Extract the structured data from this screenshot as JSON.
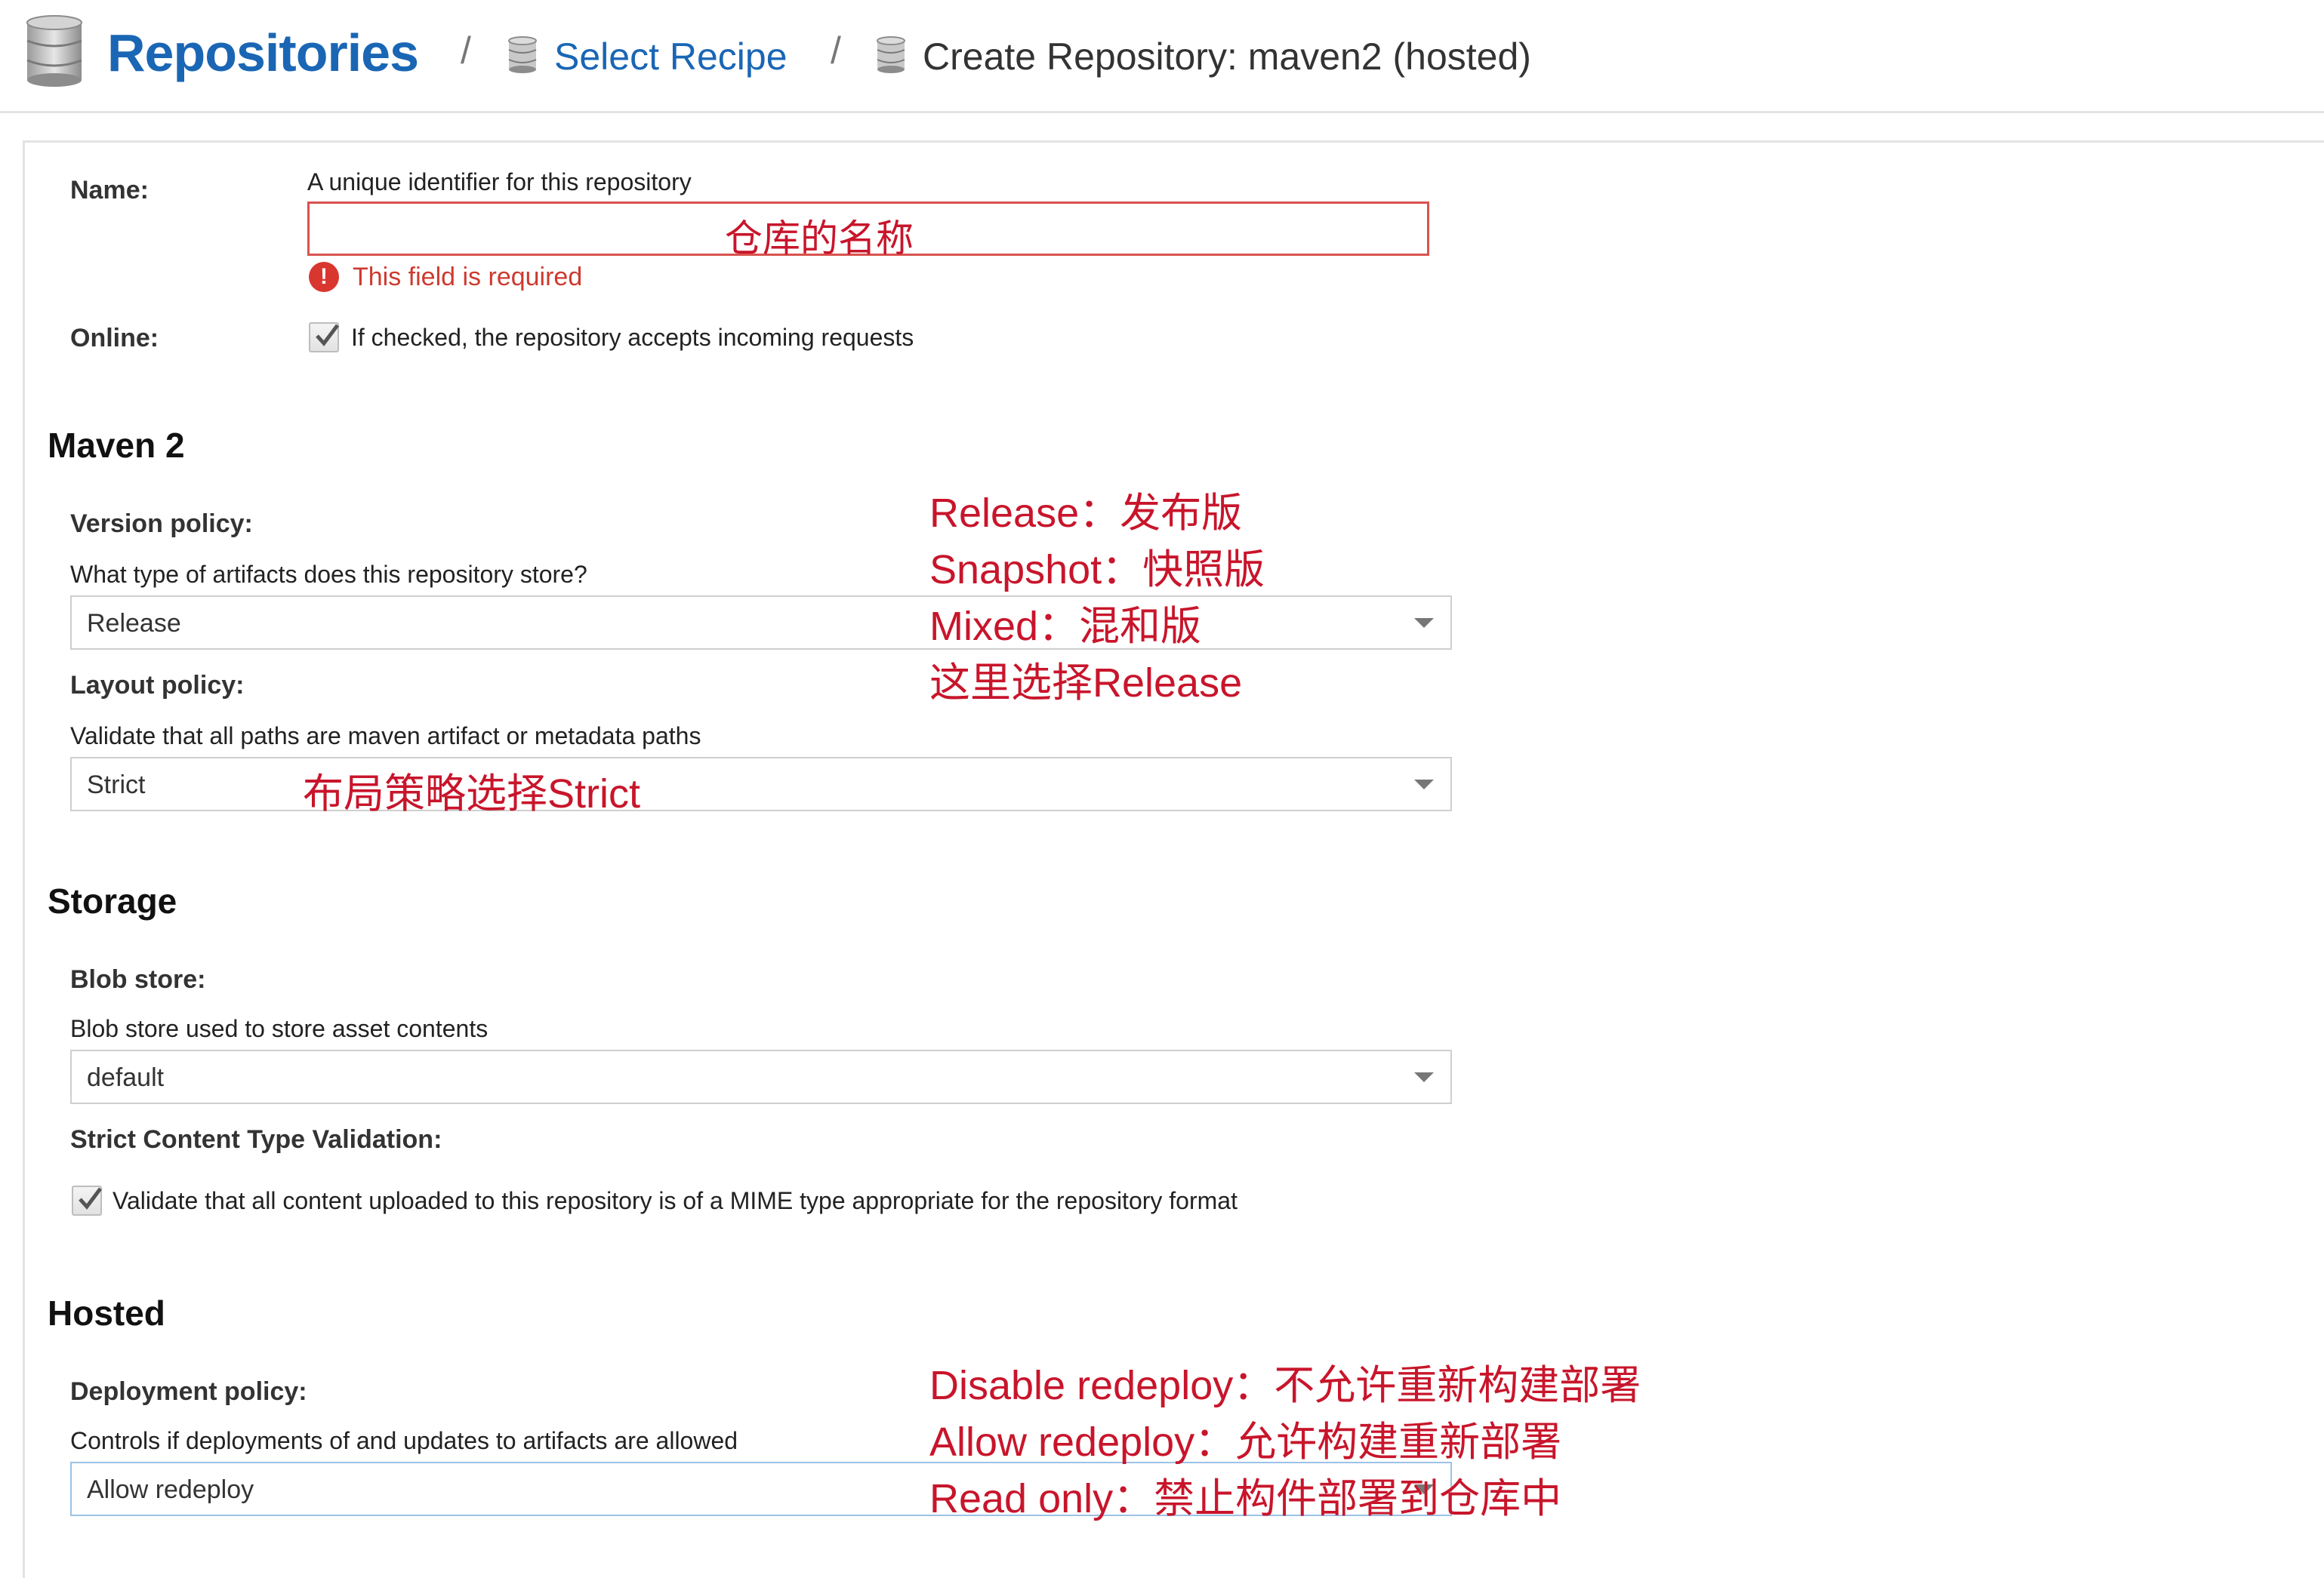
{
  "breadcrumb": {
    "root": "Repositories",
    "separator": "/",
    "step2": "Select Recipe",
    "current": "Create Repository: maven2 (hosted)"
  },
  "form": {
    "name": {
      "label": "Name:",
      "help": "A unique identifier for this repository",
      "error": "This field is required",
      "annotation": "仓库的名称"
    },
    "online": {
      "label": "Online:",
      "help": "If checked, the repository accepts incoming requests",
      "checked": true
    },
    "maven": {
      "title": "Maven 2",
      "version_policy": {
        "label": "Version policy:",
        "help": "What type of artifacts does this repository store?",
        "value": "Release"
      },
      "layout_policy": {
        "label": "Layout policy:",
        "help": "Validate that all paths are maven artifact or metadata paths",
        "value": "Strict",
        "annotation": "布局策略选择Strict"
      },
      "annotations": [
        "Release：发布版",
        "Snapshot：快照版",
        "Mixed：混和版",
        "这里选择Release"
      ]
    },
    "storage": {
      "title": "Storage",
      "blob_store": {
        "label": "Blob store:",
        "help": "Blob store used to store asset contents",
        "value": "default"
      },
      "strict_content": {
        "label": "Strict Content Type Validation:",
        "help": "Validate that all content uploaded to this repository is of a MIME type appropriate for the repository format",
        "checked": true
      }
    },
    "hosted": {
      "title": "Hosted",
      "deployment_policy": {
        "label": "Deployment policy:",
        "help": "Controls if deployments of and updates to artifacts are allowed",
        "value": "Allow redeploy"
      },
      "annotations": [
        "Disable redeploy：不允许重新构建部署",
        "Allow redeploy：允许构建重新部署",
        "Read only：禁止构件部署到仓库中"
      ]
    }
  },
  "colors": {
    "link": "#1a66b5",
    "error": "#d9362f",
    "annotation": "#c8152b"
  }
}
